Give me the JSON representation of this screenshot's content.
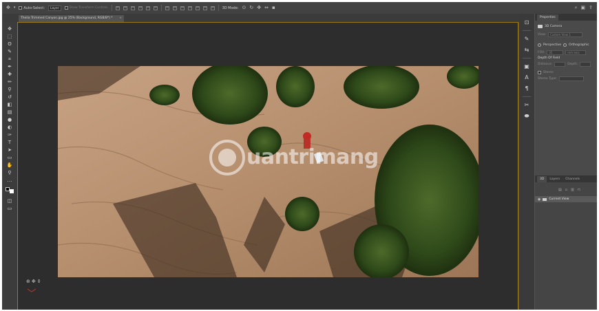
{
  "options_bar": {
    "move_icon": "move-tool-icon",
    "auto_select_label": "Auto-Select:",
    "layer_dropdown_value": "Layer",
    "transform_controls_label": "Show Transform Controls",
    "mode_label": "3D Mode:",
    "right_icons": [
      "search-icon",
      "workspace-icon",
      "share-icon"
    ]
  },
  "document": {
    "tab_title": "Thelia Trimmed Canyon.jpg @ 25% (Background, RGB/8*) *",
    "close_glyph": "×"
  },
  "tools": [
    "move-tool-icon",
    "marquee-tool-icon",
    "lasso-tool-icon",
    "quick-select-tool-icon",
    "crop-tool-icon",
    "eyedropper-tool-icon",
    "healing-brush-tool-icon",
    "brush-tool-icon",
    "clone-stamp-tool-icon",
    "history-brush-tool-icon",
    "eraser-tool-icon",
    "gradient-tool-icon",
    "blur-tool-icon",
    "dodge-tool-icon",
    "pen-tool-icon",
    "type-tool-icon",
    "path-select-tool-icon",
    "rectangle-tool-icon",
    "hand-tool-icon",
    "zoom-tool-icon"
  ],
  "tool_glyphs": [
    "✥",
    "⬚",
    "ʘ",
    "✎",
    "⌗",
    "✒",
    "✚",
    "✏",
    "⚲",
    "↺",
    "◧",
    "▤",
    "●",
    "◐",
    "✑",
    "T",
    "➤",
    "▭",
    "✋",
    "⚲"
  ],
  "watermark": {
    "text": "uantrimang"
  },
  "canvas_gizmo": {
    "icons": [
      "orbit-icon",
      "pan-icon",
      "dolly-icon"
    ],
    "glyphs": [
      "⊕",
      "✥",
      "⇕"
    ]
  },
  "properties_panel": {
    "tab_label": "Properties",
    "camera_label": "3D Camera",
    "view_label": "View:",
    "view_value": "Custom View 1",
    "perspective_label": "Perspective",
    "orthographic_label": "Orthographic",
    "fov_label": "FOV:",
    "fov_value": "35",
    "fov_unit": "mm lens",
    "dof_label": "Depth Of Field",
    "distance_label": "Distance:",
    "depth_label": "Depth:",
    "stereo_label": "Stereo",
    "stereo_type_label": "Stereo Type:"
  },
  "layers_panel": {
    "tabs": [
      "3D",
      "Layers",
      "Channels"
    ],
    "layer_name": "Current View",
    "row_icons": [
      "eye-icon",
      "folder-icon"
    ],
    "bottom_icons": [
      "filter-icon",
      "new-icon",
      "delete-icon",
      "lock-icon"
    ]
  },
  "side_icons": [
    "history-icon",
    "brush-settings-icon",
    "adjustments-icon",
    "libraries-icon",
    "character-icon",
    "paragraph-icon",
    "tools-icon",
    "3d-icon"
  ],
  "side_glyphs": [
    "⊡",
    "✎",
    "⇆",
    "▣",
    "A",
    "¶",
    "✂",
    "⬬"
  ],
  "colors": {
    "app_bg": "#535353",
    "canvas_bg": "#2d2d2d",
    "canvas_border": "#a07a12",
    "panel_bg": "#4a4a4a"
  }
}
